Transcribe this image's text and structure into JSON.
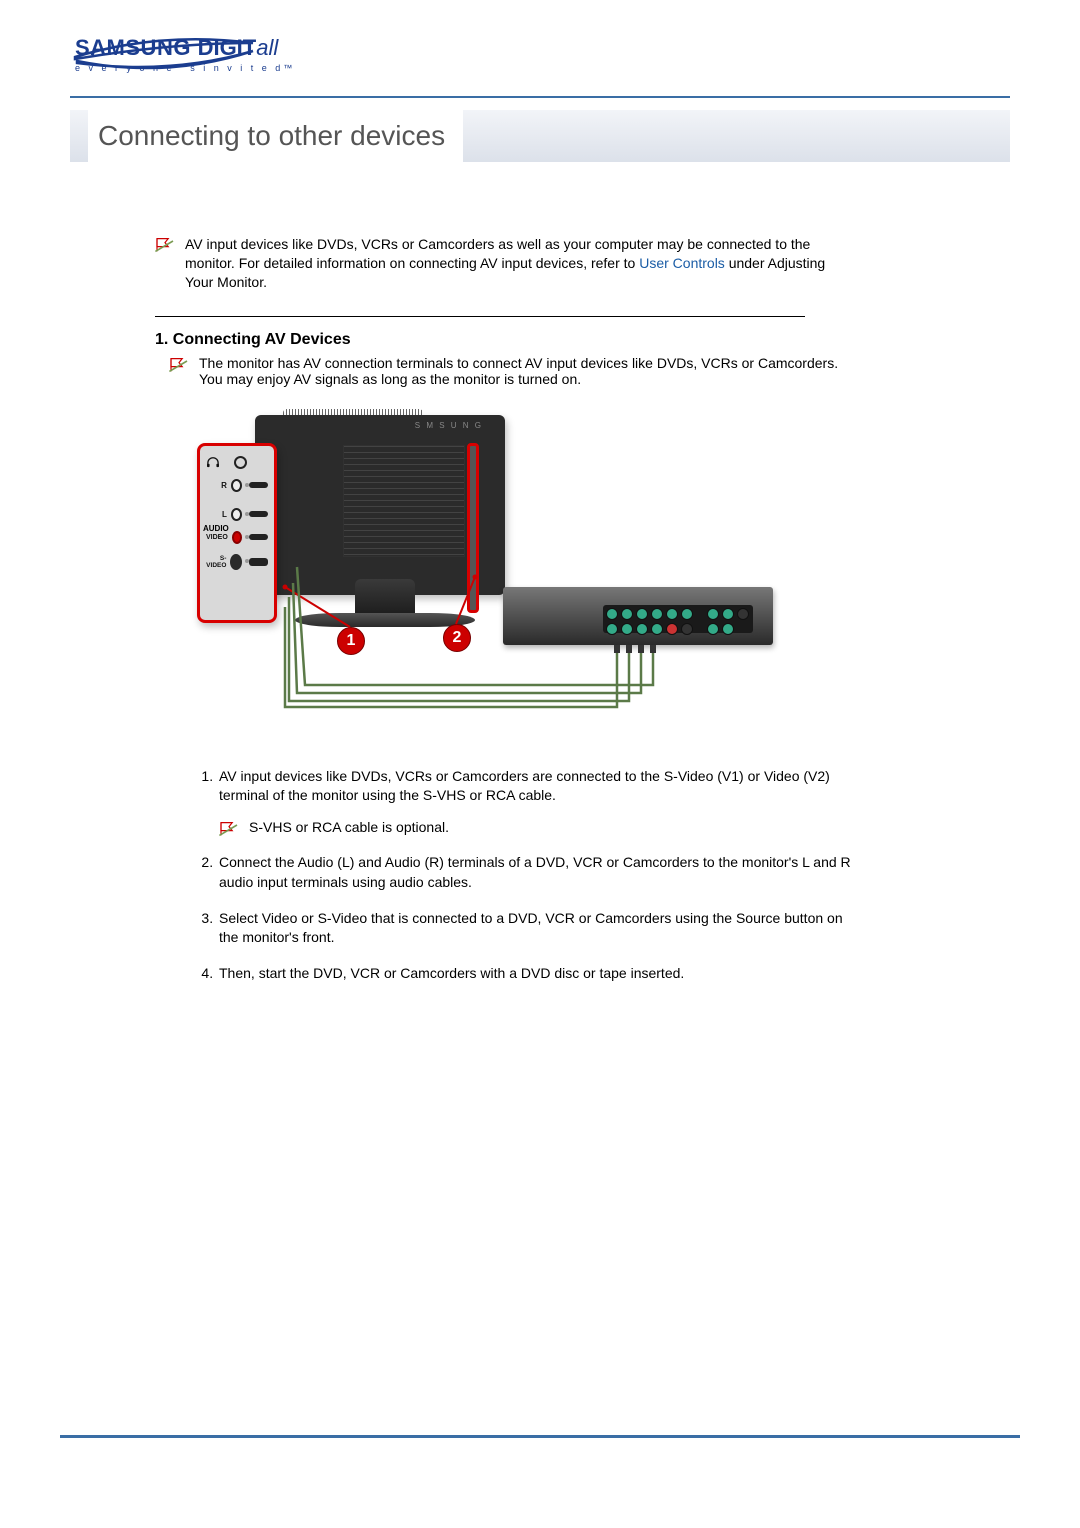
{
  "logo": {
    "brand1": "SAMSUNG ",
    "brand2": "DIGIT",
    "brand3": "all",
    "tagline": "e v e r y o n e ' s   i n v i t e d™"
  },
  "page_title": "Connecting to other devices",
  "intro": {
    "text_before_link": "AV input devices like DVDs, VCRs or Camcorders as well as your computer may be connected to the monitor. For detailed information on connecting AV input devices, refer to ",
    "link_text": "User Controls",
    "text_after_link": " under Adjusting Your Monitor."
  },
  "section1": {
    "heading": "1. Connecting AV Devices",
    "description": "The monitor has AV connection terminals to connect AV input devices like DVDs, VCRs or Camcorders. You may enjoy AV signals as long as the monitor is turned on."
  },
  "diagram": {
    "ports": {
      "audio": "AUDIO",
      "r": "R",
      "l": "L",
      "video": "VIDEO",
      "svideo": "S-VIDEO"
    },
    "marker1": "1",
    "marker2": "2"
  },
  "steps": {
    "item1": "AV input devices like DVDs, VCRs or Camcorders are connected to the S-Video (V1) or Video (V2) terminal of the monitor using the S-VHS or RCA cable.",
    "optional_note": "S-VHS or RCA cable is optional.",
    "item2": "Connect the Audio (L) and Audio (R) terminals of a DVD, VCR or Camcorders to the monitor's L and R audio input terminals using audio cables.",
    "item3": "Select Video or S-Video that is connected to a DVD, VCR or Camcorders using the Source button on the monitor's front.",
    "item4": "Then, start the DVD, VCR or Camcorders with a DVD disc or tape inserted."
  }
}
